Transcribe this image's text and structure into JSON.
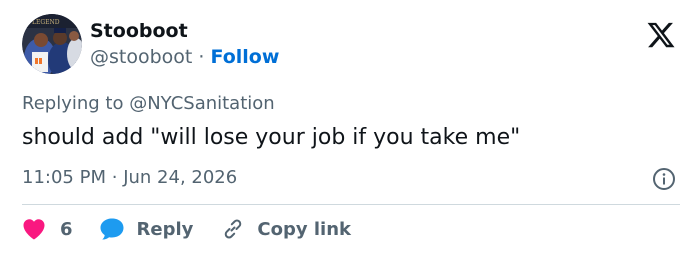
{
  "tweet": {
    "author": {
      "display_name": "Stooboot",
      "handle": "@stooboot",
      "separator": "·",
      "follow_label": "Follow",
      "avatar_text": "LEGEND"
    },
    "replying_prefix": "Replying to",
    "replying_to": "@NYCSanitation",
    "text": "should add \"will lose your job if you take me\"",
    "time": "11:05 PM",
    "meta_separator": "·",
    "date": "Jun 24, 2026"
  },
  "actions": {
    "like_count": "6",
    "reply_label": "Reply",
    "copy_link_label": "Copy link"
  },
  "colors": {
    "heart": "#f91880",
    "reply_bubble": "#1d9bf0",
    "follow": "#006fd6",
    "secondary_text": "#536471",
    "primary_text": "#0f1419",
    "divider": "#cfd9de"
  },
  "icons": {
    "logo": "x-logo-icon",
    "info": "info-icon",
    "like": "heart-icon",
    "reply": "speech-bubble-icon",
    "copy": "link-icon"
  }
}
